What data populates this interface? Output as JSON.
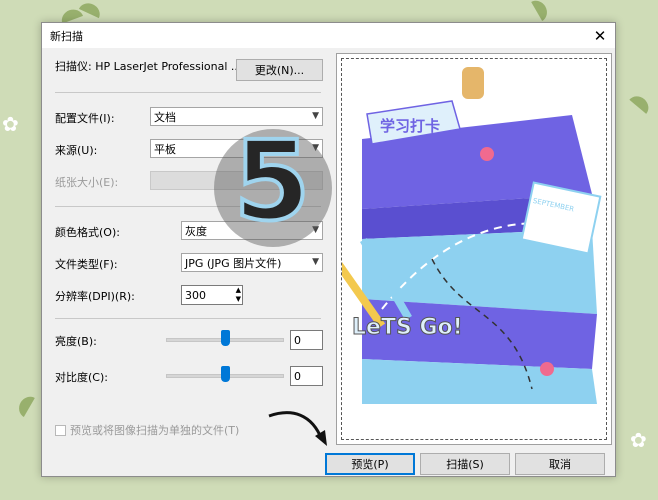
{
  "dialog": {
    "title": "新扫描"
  },
  "scanner": {
    "label": "扫描仪: HP LaserJet Professional ...",
    "change_button": "更改(N)..."
  },
  "profile": {
    "label": "配置文件(I):",
    "value": "文档"
  },
  "source": {
    "label": "来源(U):",
    "value": "平板"
  },
  "paper_size": {
    "label": "纸张大小(E):",
    "value": ""
  },
  "color_format": {
    "label": "颜色格式(O):",
    "value": "灰度"
  },
  "file_type": {
    "label": "文件类型(F):",
    "value": "JPG (JPG 图片文件)"
  },
  "resolution": {
    "label": "分辨率(DPI)(R):",
    "value": "300"
  },
  "brightness": {
    "label": "亮度(B):",
    "value": "0",
    "level": 0.5
  },
  "contrast": {
    "label": "对比度(C):",
    "value": "0",
    "level": 0.5
  },
  "separate_files": {
    "label": "预览或将图像扫描为单独的文件(T)",
    "checked": false
  },
  "buttons": {
    "preview": "预览(P)",
    "scan": "扫描(S)",
    "cancel": "取消"
  },
  "preview_image": {
    "title_sticker": "学习打卡",
    "calendar_label": "SEPTEMBER",
    "slogan": "LeTS Go!",
    "colors": {
      "dark_blue": "#6f63e3",
      "light_blue": "#8ed1f0",
      "pink": "#f06a8f"
    }
  },
  "overlay": {
    "number": "5"
  }
}
